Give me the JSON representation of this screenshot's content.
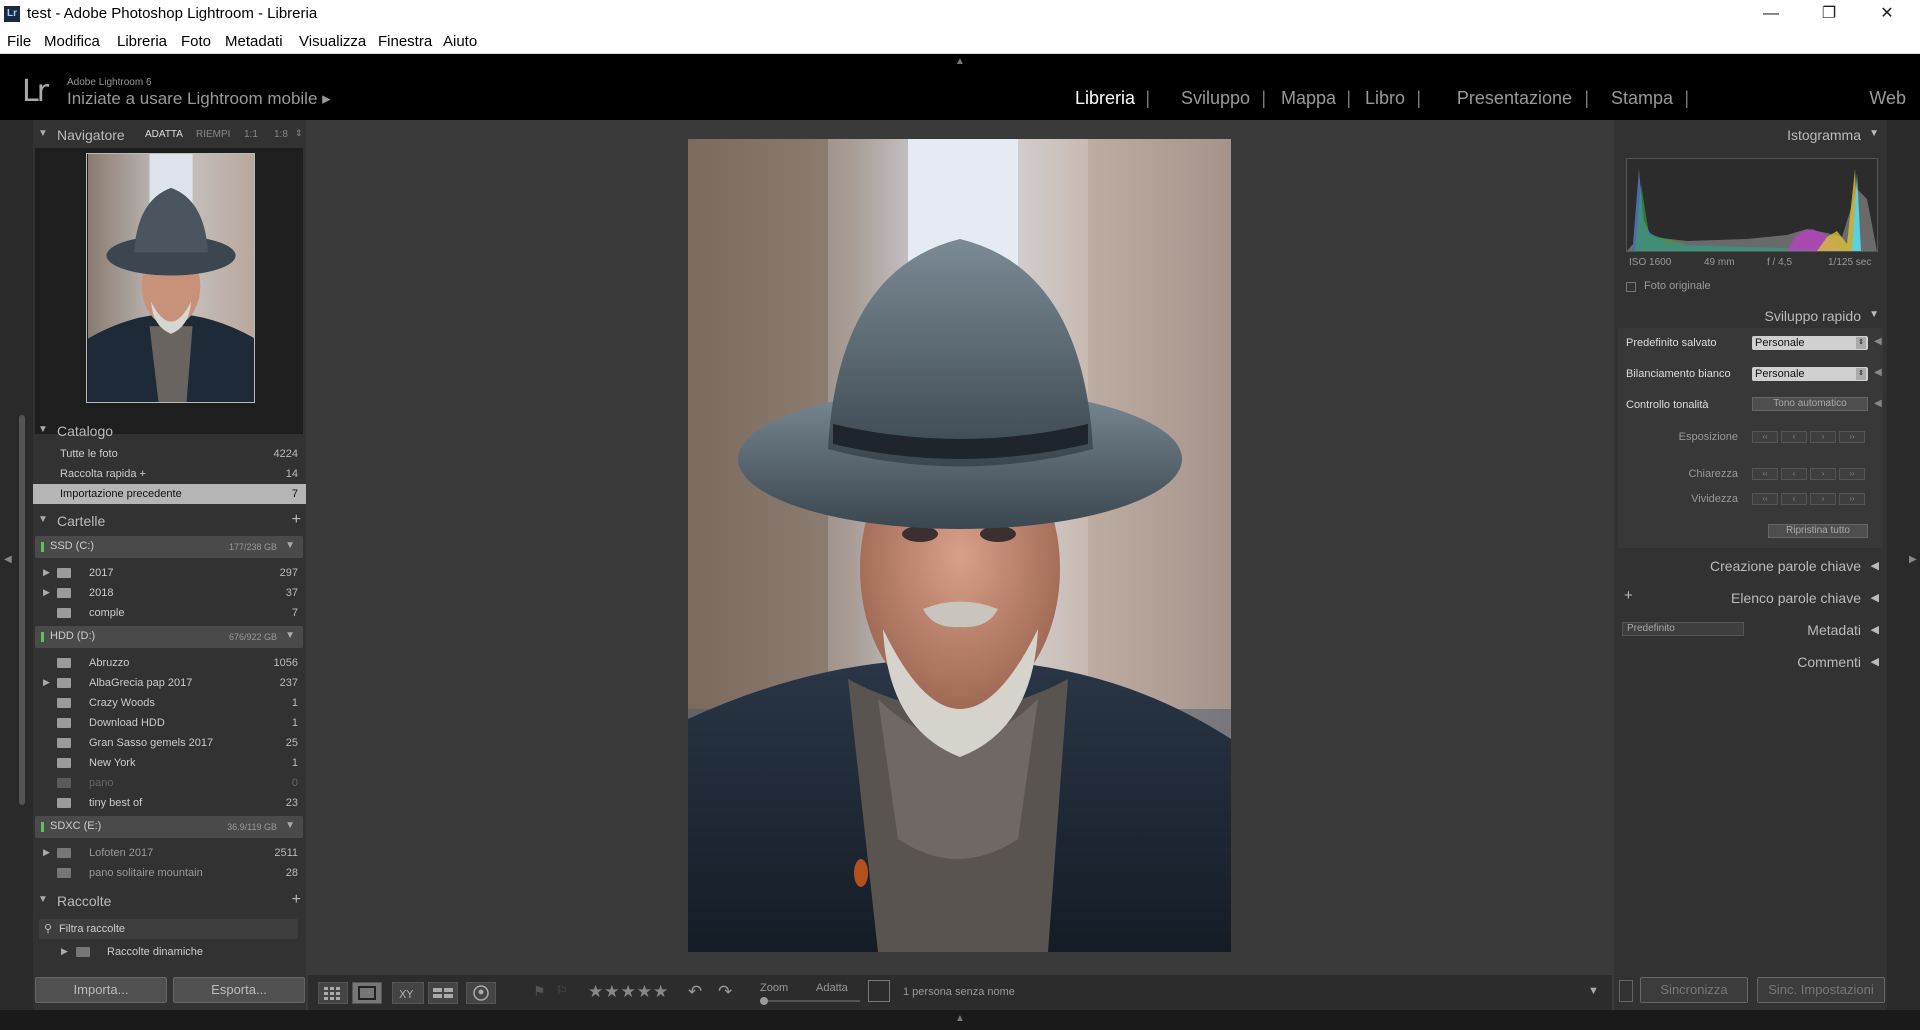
{
  "window": {
    "title": "test - Adobe Photoshop Lightroom - Libreria",
    "app_icon": "Lr"
  },
  "menu": [
    "File",
    "Modifica",
    "Libreria",
    "Foto",
    "Metadati",
    "Visualizza",
    "Finestra",
    "Aiuto"
  ],
  "identity": {
    "logo": "Lr",
    "version": "Adobe Lightroom 6",
    "mobile_label": "Iniziate a usare Lightroom mobile ▸"
  },
  "modules": [
    "Libreria",
    "Sviluppo",
    "Mappa",
    "Libro",
    "Presentazione",
    "Stampa",
    "Web"
  ],
  "active_module": "Libreria",
  "navigator": {
    "title": "Navigatore",
    "zoom_options": [
      "ADATTA",
      "RIEMPI",
      "1:1",
      "1:8"
    ]
  },
  "catalog": {
    "title": "Catalogo",
    "items": [
      {
        "label": "Tutte le foto",
        "count": "4224"
      },
      {
        "label": "Raccolta rapida +",
        "count": "14"
      },
      {
        "label": "Importazione precedente",
        "count": "7"
      }
    ]
  },
  "folders": {
    "title": "Cartelle",
    "add": "+",
    "volumes": [
      {
        "name": "SSD (C:)",
        "size": "177/238 GB",
        "folders": [
          {
            "name": "2017",
            "count": "297",
            "expand": true
          },
          {
            "name": "2018",
            "count": "37",
            "expand": true
          },
          {
            "name": "comple",
            "count": "7",
            "expand": false
          }
        ]
      },
      {
        "name": "HDD (D:)",
        "size": "676/922 GB",
        "folders": [
          {
            "name": "Abruzzo",
            "count": "1056",
            "expand": false
          },
          {
            "name": "AlbaGrecia pap 2017",
            "count": "237",
            "expand": true
          },
          {
            "name": "Crazy Woods",
            "count": "1",
            "expand": false
          },
          {
            "name": "Download HDD",
            "count": "1",
            "expand": false
          },
          {
            "name": "Gran Sasso gemels 2017",
            "count": "25",
            "expand": false
          },
          {
            "name": "New York",
            "count": "1",
            "expand": false
          },
          {
            "name": "pano",
            "count": "0",
            "expand": false
          },
          {
            "name": "tiny best of",
            "count": "23",
            "expand": false
          }
        ]
      },
      {
        "name": "SDXC (E:)",
        "size": "36.9/119 GB",
        "folders": [
          {
            "name": "Lofoten 2017",
            "count": "2511",
            "expand": true
          },
          {
            "name": "pano solitaire mountain",
            "count": "28",
            "expand": false
          }
        ]
      }
    ]
  },
  "collections": {
    "title": "Raccolte",
    "filter_placeholder": "Filtra raccolte",
    "smart": "Raccolte dinamiche"
  },
  "left_buttons": {
    "import": "Importa...",
    "export": "Esporta..."
  },
  "toolbar": {
    "zoom_label": "Zoom",
    "fit_label": "Adatta",
    "face_info": "1 persona senza nome",
    "stars": "★★★★★"
  },
  "histogram": {
    "title": "Istogramma",
    "iso": "ISO 1600",
    "focal": "49 mm",
    "aperture": "f / 4,5",
    "shutter": "1/125 sec",
    "original_photo": "Foto originale"
  },
  "quick_develop": {
    "title": "Sviluppo rapido",
    "saved_preset_label": "Predefinito salvato",
    "saved_preset_value": "Personale",
    "white_balance_label": "Bilanciamento bianco",
    "white_balance_value": "Personale",
    "tone_label": "Controllo tonalità",
    "auto_tone": "Tono automatico",
    "exposure": "Esposizione",
    "clarity": "Chiarezza",
    "vibrance": "Vividezza",
    "reset_all": "Ripristina tutto"
  },
  "right_panels": {
    "keywording": "Creazione parole chiave",
    "keyword_list": "Elenco parole chiave",
    "metadata": "Metadati",
    "metadata_preset": "Predefinito",
    "comments": "Commenti"
  },
  "right_buttons": {
    "sync": "Sincronizza",
    "sync_settings": "Sinc. Impostazioni"
  }
}
